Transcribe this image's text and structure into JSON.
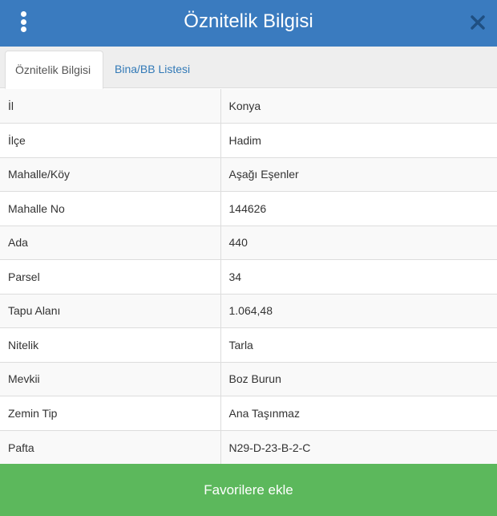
{
  "header": {
    "title": "Öznitelik Bilgisi"
  },
  "tabs": [
    {
      "label": "Öznitelik Bilgisi",
      "active": true
    },
    {
      "label": "Bina/BB Listesi",
      "active": false
    }
  ],
  "attributes": [
    {
      "key": "İl",
      "value": "Konya"
    },
    {
      "key": "İlçe",
      "value": "Hadim"
    },
    {
      "key": "Mahalle/Köy",
      "value": "Aşağı Eşenler"
    },
    {
      "key": "Mahalle No",
      "value": "144626"
    },
    {
      "key": "Ada",
      "value": "440"
    },
    {
      "key": "Parsel",
      "value": "34"
    },
    {
      "key": "Tapu Alanı",
      "value": "1.064,48"
    },
    {
      "key": "Nitelik",
      "value": "Tarla"
    },
    {
      "key": "Mevkii",
      "value": "Boz Burun"
    },
    {
      "key": "Zemin Tip",
      "value": "Ana Taşınmaz"
    },
    {
      "key": "Pafta",
      "value": "N29-D-23-B-2-C"
    }
  ],
  "actions": {
    "favorite_label": "Favorilere ekle"
  },
  "colors": {
    "header": "#3a7bbf",
    "button": "#5cb85c",
    "link": "#337ab7"
  },
  "icons": {
    "menu": "vertical-dots-icon",
    "close": "close-icon"
  }
}
